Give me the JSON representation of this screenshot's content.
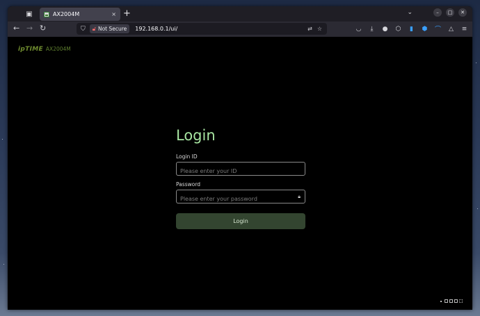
{
  "browser": {
    "tab": {
      "title": "AX2004M",
      "close_icon": "×"
    },
    "new_tab_label": "+",
    "url": "192.168.0.1/ui/",
    "security_label": "Not Secure"
  },
  "page": {
    "brand_logo": "ipTIME",
    "brand_model": "AX2004M",
    "login": {
      "title": "Login",
      "id_label": "Login ID",
      "id_placeholder": "Please enter your ID",
      "password_label": "Password",
      "password_placeholder": "Please enter your password",
      "button_label": "Login"
    }
  },
  "colors": {
    "accent_green": "#a6e4a0",
    "button_bg": "#334530",
    "brand_green": "#6f8c2f"
  }
}
